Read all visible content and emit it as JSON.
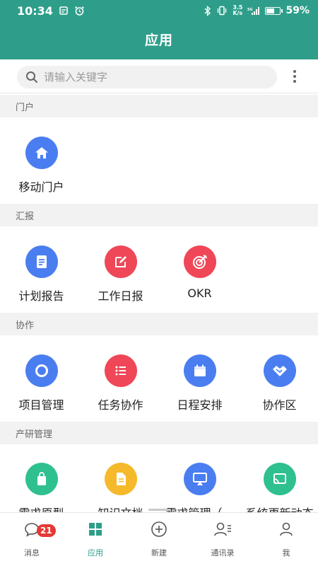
{
  "status_bar": {
    "time": "10:34",
    "net_speed_top": "3.5",
    "net_speed_bottom": "K/s",
    "battery": "59%",
    "battery_level": 0.59
  },
  "header": {
    "title": "应用"
  },
  "search": {
    "placeholder": "请输入关键字"
  },
  "sections": [
    {
      "title": "门户",
      "items": [
        {
          "label": "移动门户",
          "icon": "home-icon",
          "color": "#4a7ef0"
        }
      ]
    },
    {
      "title": "汇报",
      "items": [
        {
          "label": "计划报告",
          "icon": "document-icon",
          "color": "#4a7ef0"
        },
        {
          "label": "工作日报",
          "icon": "edit-icon",
          "color": "#ef4757"
        },
        {
          "label": "OKR",
          "icon": "target-icon",
          "color": "#ef4757"
        }
      ]
    },
    {
      "title": "协作",
      "items": [
        {
          "label": "项目管理",
          "icon": "project-icon",
          "color": "#4a7ef0"
        },
        {
          "label": "任务协作",
          "icon": "list-icon",
          "color": "#ef4757"
        },
        {
          "label": "日程安排",
          "icon": "calendar-icon",
          "color": "#4a7ef0"
        },
        {
          "label": "协作区",
          "icon": "handshake-icon",
          "color": "#4a7ef0"
        }
      ]
    },
    {
      "title": "产研管理",
      "items": [
        {
          "label": "需求原型",
          "icon": "bag-icon",
          "color": "#2fc08f"
        },
        {
          "label": "知识文档",
          "icon": "file-icon",
          "color": "#f6b92b"
        },
        {
          "label": "需求管理（…",
          "icon": "screen-icon",
          "color": "#4a7ef0"
        },
        {
          "label": "系统更新动态",
          "icon": "cast-icon",
          "color": "#2fc08f"
        }
      ]
    }
  ],
  "tabs": [
    {
      "label": "消息",
      "badge": "21",
      "icon": "message-icon"
    },
    {
      "label": "应用",
      "icon": "apps-grid-icon",
      "active": true
    },
    {
      "label": "新建",
      "icon": "plus-circle-icon"
    },
    {
      "label": "通讯录",
      "icon": "contacts-icon"
    },
    {
      "label": "我",
      "icon": "profile-icon"
    }
  ],
  "colors": {
    "primary": "#2e9e8a",
    "badge": "#e53935"
  }
}
